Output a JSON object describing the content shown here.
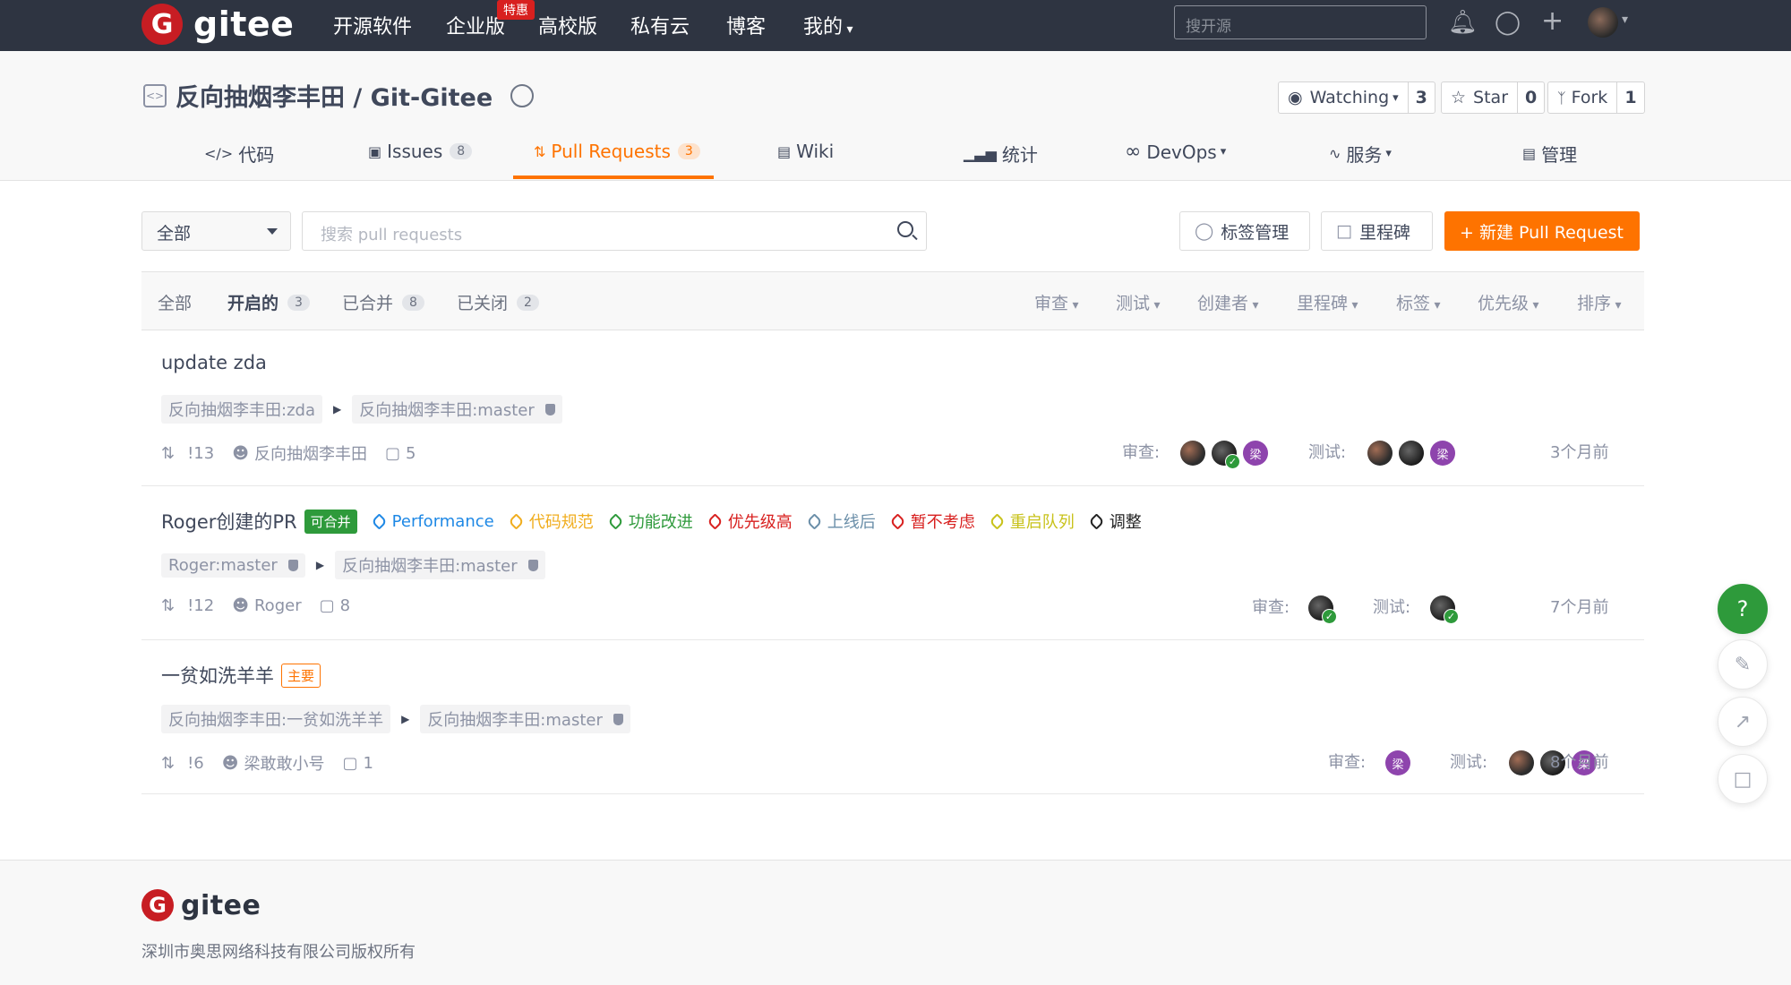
{
  "topnav": {
    "logo_mark": "G",
    "logo_text": "gitee",
    "items": [
      "开源软件",
      "企业版",
      "高校版",
      "私有云",
      "博客",
      "我的"
    ],
    "badge": "特惠",
    "search_placeholder": "搜开源",
    "icons": [
      "bell-icon",
      "lightbulb-icon",
      "plus-icon"
    ]
  },
  "repo": {
    "title": "反向抽烟李丰田 / Git-Gitee",
    "watch_label": "Watching",
    "watch_count": "3",
    "star_label": "Star",
    "star_count": "0",
    "fork_label": "Fork",
    "fork_count": "1",
    "tabs": [
      {
        "label": "代码",
        "count": ""
      },
      {
        "label": "Issues",
        "count": "8"
      },
      {
        "label": "Pull Requests",
        "count": "3"
      },
      {
        "label": "Wiki",
        "count": ""
      },
      {
        "label": "统计",
        "count": ""
      },
      {
        "label": "DevOps",
        "count": ""
      },
      {
        "label": "服务",
        "count": ""
      },
      {
        "label": "管理",
        "count": ""
      }
    ],
    "active_tab": "Pull Requests"
  },
  "toolbar": {
    "select_value": "全部",
    "search_placeholder": "搜索 pull requests",
    "label_btn": "标签管理",
    "milestone_btn": "里程碑",
    "new_pr_btn": "+ 新建 Pull Request"
  },
  "filters": {
    "states": [
      {
        "label": "全部",
        "count": ""
      },
      {
        "label": "开启的",
        "count": "3"
      },
      {
        "label": "已合并",
        "count": "8"
      },
      {
        "label": "已关闭",
        "count": "2"
      }
    ],
    "dropdowns": [
      "审查",
      "测试",
      "创建者",
      "里程碑",
      "标签",
      "优先级",
      "排序"
    ]
  },
  "prs": [
    {
      "title": "update zda",
      "source": "反向抽烟李丰田:zda",
      "target": "反向抽烟李丰田:master",
      "number": "!13",
      "author": "反向抽烟李丰田",
      "comments": "5",
      "review_label": "审查:",
      "test_label": "测试:",
      "time": "3个月前"
    },
    {
      "title": "Roger创建的PR",
      "badge": "可合并",
      "tags": [
        {
          "label": "Performance",
          "color": "#1e88e5"
        },
        {
          "label": "代码规范",
          "color": "#f0ad1e"
        },
        {
          "label": "功能改进",
          "color": "#2e9a3b"
        },
        {
          "label": "优先级高",
          "color": "#d8201f"
        },
        {
          "label": "上线后",
          "color": "#6a8ea8"
        },
        {
          "label": "暂不考虑",
          "color": "#d8201f"
        },
        {
          "label": "重启队列",
          "color": "#c8c21a"
        },
        {
          "label": "调整",
          "color": "#222222"
        }
      ],
      "source": "Roger:master",
      "target": "反向抽烟李丰田:master",
      "number": "!12",
      "author": "Roger",
      "comments": "8",
      "review_label": "审查:",
      "test_label": "测试:",
      "time": "7个月前"
    },
    {
      "title": "一贫如洗羊羊",
      "badge": "主要",
      "source": "反向抽烟李丰田:一贫如洗羊羊",
      "target": "反向抽烟李丰田:master",
      "number": "!6",
      "author": "梁敢敢小号",
      "comments": "1",
      "review_label": "审查:",
      "test_label": "测试:",
      "time": "8个月前"
    }
  ],
  "avatar_initial": "梁",
  "footer": {
    "logo_text": "gitee",
    "copyright": "深圳市奥思网络科技有限公司版权所有"
  },
  "float": {
    "help": "?"
  },
  "colors": {
    "nav_bg": "#2e3441",
    "accent": "#fe7300",
    "brand_red": "#c71d23",
    "merge_green": "#2e9a3b"
  }
}
